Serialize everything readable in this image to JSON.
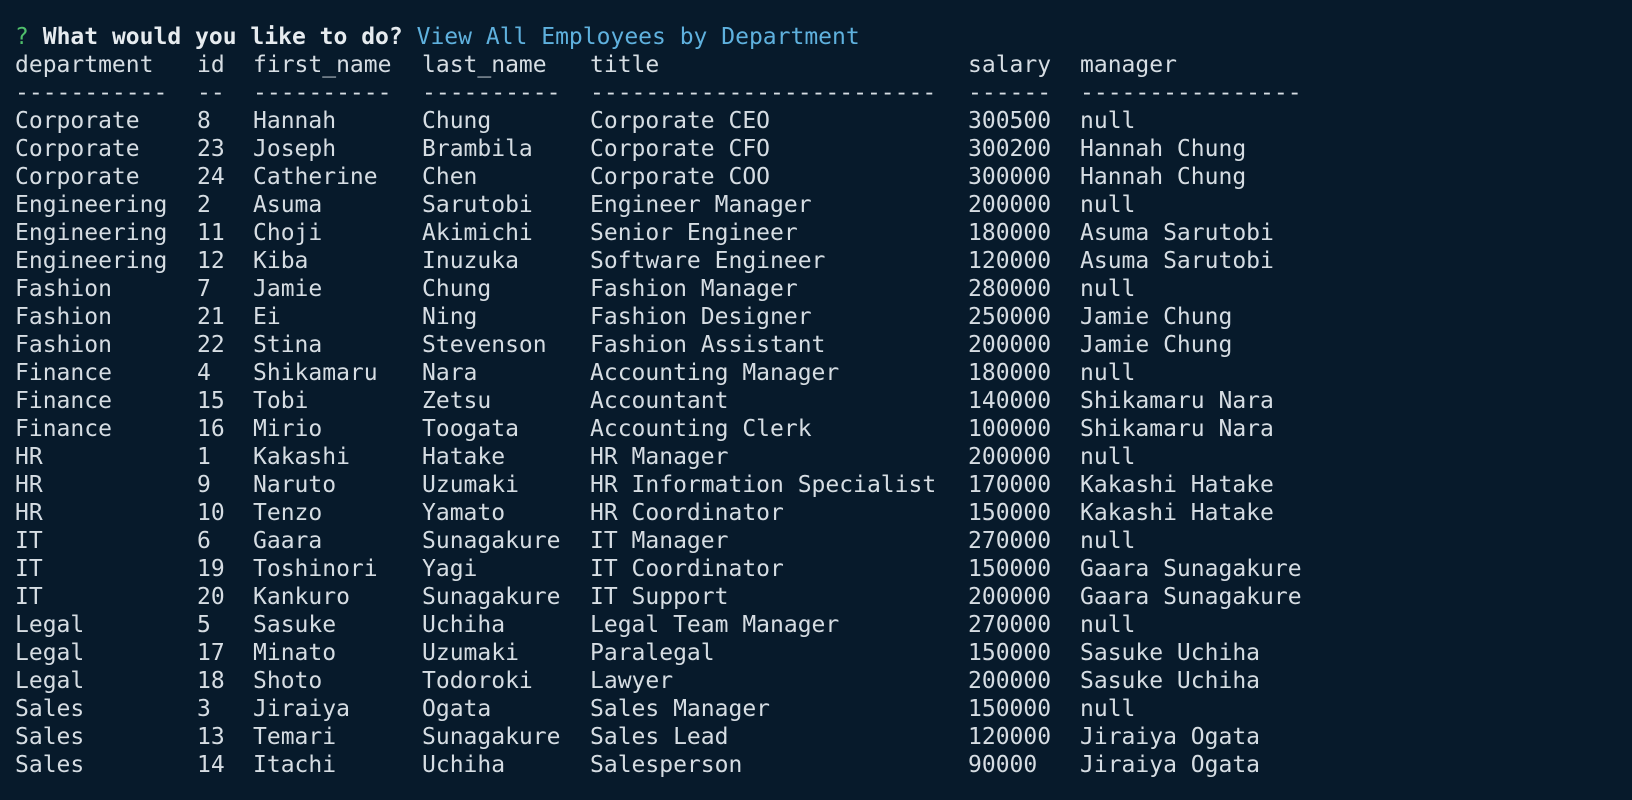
{
  "prompt": {
    "mark": "?",
    "question": "What would you like to do?",
    "answer": "View All Employees by Department"
  },
  "table": {
    "headers": [
      "department",
      "id",
      "first_name",
      "last_name",
      "title",
      "salary",
      "manager"
    ],
    "separators": [
      "-----------",
      "--",
      "----------",
      "----------",
      "-------------------------",
      "------",
      "----------------"
    ],
    "rows": [
      [
        "Corporate",
        "8",
        "Hannah",
        "Chung",
        "Corporate CEO",
        "300500",
        "null"
      ],
      [
        "Corporate",
        "23",
        "Joseph",
        "Brambila",
        "Corporate CFO",
        "300200",
        "Hannah Chung"
      ],
      [
        "Corporate",
        "24",
        "Catherine",
        "Chen",
        "Corporate COO",
        "300000",
        "Hannah Chung"
      ],
      [
        "Engineering",
        "2",
        "Asuma",
        "Sarutobi",
        "Engineer Manager",
        "200000",
        "null"
      ],
      [
        "Engineering",
        "11",
        "Choji",
        "Akimichi",
        "Senior Engineer",
        "180000",
        "Asuma Sarutobi"
      ],
      [
        "Engineering",
        "12",
        "Kiba",
        "Inuzuka",
        "Software Engineer",
        "120000",
        "Asuma Sarutobi"
      ],
      [
        "Fashion",
        "7",
        "Jamie",
        "Chung",
        "Fashion Manager",
        "280000",
        "null"
      ],
      [
        "Fashion",
        "21",
        "Ei",
        "Ning",
        "Fashion Designer",
        "250000",
        "Jamie Chung"
      ],
      [
        "Fashion",
        "22",
        "Stina",
        "Stevenson",
        "Fashion Assistant",
        "200000",
        "Jamie Chung"
      ],
      [
        "Finance",
        "4",
        "Shikamaru",
        "Nara",
        "Accounting Manager",
        "180000",
        "null"
      ],
      [
        "Finance",
        "15",
        "Tobi",
        "Zetsu",
        "Accountant",
        "140000",
        "Shikamaru Nara"
      ],
      [
        "Finance",
        "16",
        "Mirio",
        "Toogata",
        "Accounting Clerk",
        "100000",
        "Shikamaru Nara"
      ],
      [
        "HR",
        "1",
        "Kakashi",
        "Hatake",
        "HR Manager",
        "200000",
        "null"
      ],
      [
        "HR",
        "9",
        "Naruto",
        "Uzumaki",
        "HR Information Specialist",
        "170000",
        "Kakashi Hatake"
      ],
      [
        "HR",
        "10",
        "Tenzo",
        "Yamato",
        "HR Coordinator",
        "150000",
        "Kakashi Hatake"
      ],
      [
        "IT",
        "6",
        "Gaara",
        "Sunagakure",
        "IT Manager",
        "270000",
        "null"
      ],
      [
        "IT",
        "19",
        "Toshinori",
        "Yagi",
        "IT Coordinator",
        "150000",
        "Gaara Sunagakure"
      ],
      [
        "IT",
        "20",
        "Kankuro",
        "Sunagakure",
        "IT Support",
        "200000",
        "Gaara Sunagakure"
      ],
      [
        "Legal",
        "5",
        "Sasuke",
        "Uchiha",
        "Legal Team Manager",
        "270000",
        "null"
      ],
      [
        "Legal",
        "17",
        "Minato",
        "Uzumaki",
        "Paralegal",
        "150000",
        "Sasuke Uchiha"
      ],
      [
        "Legal",
        "18",
        "Shoto",
        "Todoroki",
        "Lawyer",
        "200000",
        "Sasuke Uchiha"
      ],
      [
        "Sales",
        "3",
        "Jiraiya",
        "Ogata",
        "Sales Manager",
        "150000",
        "null"
      ],
      [
        "Sales",
        "13",
        "Temari",
        "Sunagakure",
        "Sales Lead",
        "120000",
        "Jiraiya Ogata"
      ],
      [
        "Sales",
        "14",
        "Itachi",
        "Uchiha",
        "Salesperson",
        "90000",
        "Jiraiya Ogata"
      ]
    ]
  },
  "colors": {
    "background": "#071a2b",
    "text": "#d6dde3",
    "prompt_mark": "#4fbf6b",
    "prompt_answer": "#5fb1de"
  }
}
